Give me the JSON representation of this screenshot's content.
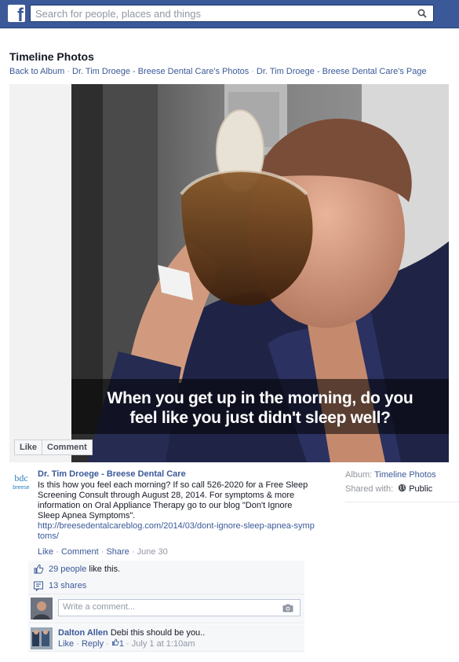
{
  "topbar": {
    "logo_letter": "f",
    "search_placeholder": "Search for people, places and things"
  },
  "header": {
    "title": "Timeline Photos",
    "breadcrumbs": [
      "Back to Album",
      "Dr. Tim Droege - Breese Dental Care's Photos",
      "Dr. Tim Droege - Breese Dental Care's Page"
    ],
    "separator": "·"
  },
  "photo": {
    "caption_line1": "When you get up in the morning, do you",
    "caption_line2": "feel like you just didn't sleep well?",
    "actions": [
      "Like",
      "Comment"
    ]
  },
  "post": {
    "logo_text": "bdc",
    "logo_sub": "breese",
    "author": "Dr. Tim Droege - Breese Dental Care",
    "message": "Is this how you feel each morning? If so call 526-2020 for a Free Sleep Screening Consult through August 28, 2014. For symptoms & more information on Oral Appliance Therapy go to our blog \"Don't Ignore Sleep Apnea Symptoms\".",
    "link": "http://breesedentalcareblog.com/2014/03/dont-ignore-sleep-apnea-symptoms/",
    "meta": {
      "like": "Like",
      "comment": "Comment",
      "share": "Share",
      "date": "June 30"
    },
    "likes_count": "29 people",
    "likes_suffix": "like this.",
    "shares": "13 shares",
    "comment_placeholder": "Write a comment...",
    "comments": [
      {
        "name": "Dalton Allen",
        "text": "Debi this should be you..",
        "like": "Like",
        "reply": "Reply",
        "like_count": "1",
        "time": "July 1 at 1:10am"
      }
    ]
  },
  "side": {
    "album_label": "Album:",
    "album_value": "Timeline Photos",
    "shared_label": "Shared with:",
    "shared_value": "Public"
  },
  "colors": {
    "brand": "#3b5998",
    "link": "#3b5998",
    "muted": "#9197a3"
  }
}
